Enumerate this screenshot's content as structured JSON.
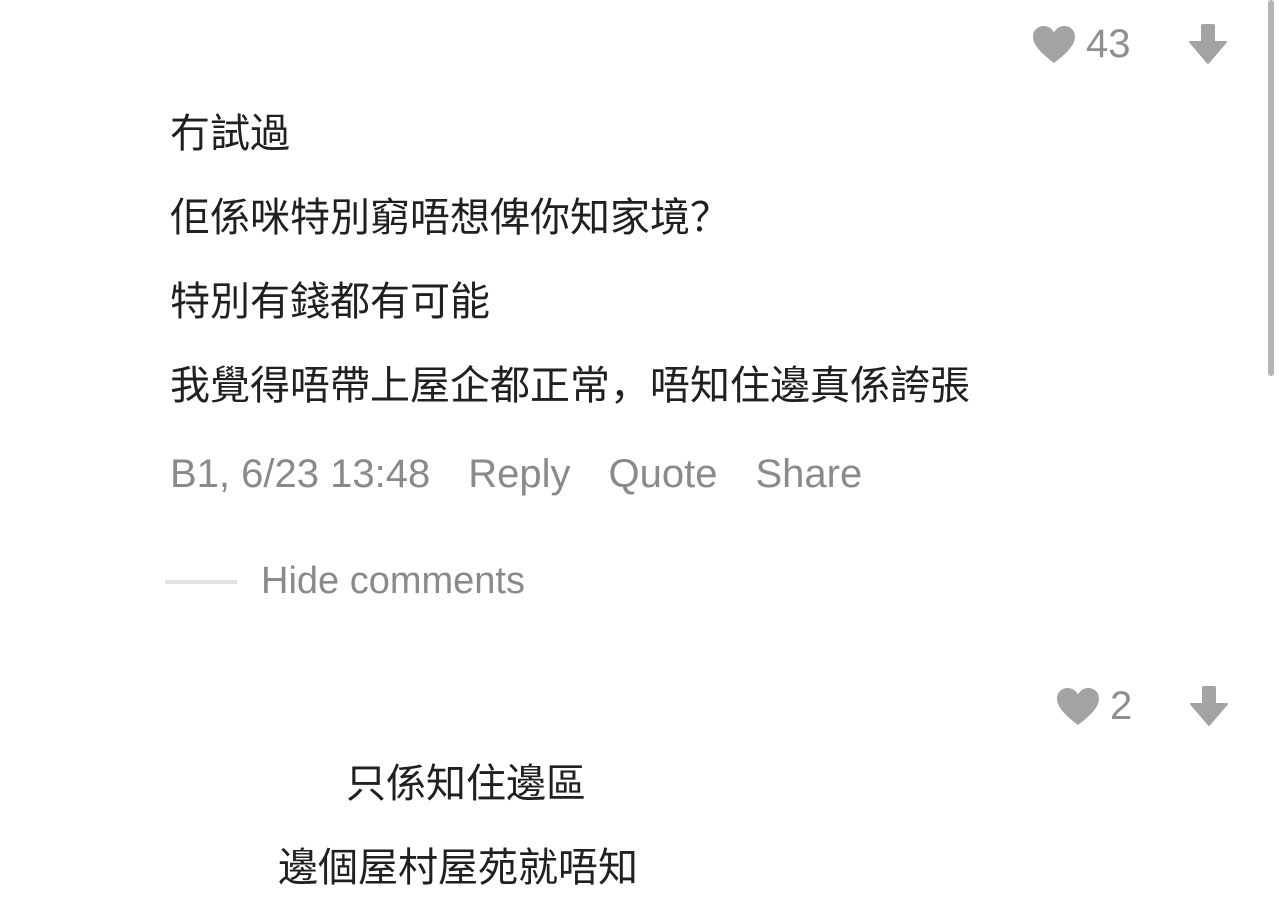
{
  "comment": {
    "likes": "43",
    "lines": [
      "冇試過",
      "佢係咪特別窮唔想俾你知家境？",
      "特別有錢都有可能",
      "我覺得唔帶上屋企都正常，唔知住邊真係誇張"
    ],
    "floor_time": "B1, 6/23 13:48",
    "reply_label": "Reply",
    "quote_label": "Quote",
    "share_label": "Share"
  },
  "hide_comments_label": "Hide comments",
  "reply": {
    "likes": "2",
    "lines": [
      "只係知住邊區",
      "邊個屋村屋苑就唔知"
    ]
  },
  "icons": {
    "like": "heart-icon",
    "dislike": "thumb-down-arrow-icon"
  },
  "colors": {
    "icon_gray": "#a3a3a3",
    "meta_gray": "#8a8a8a",
    "text": "#202020"
  }
}
